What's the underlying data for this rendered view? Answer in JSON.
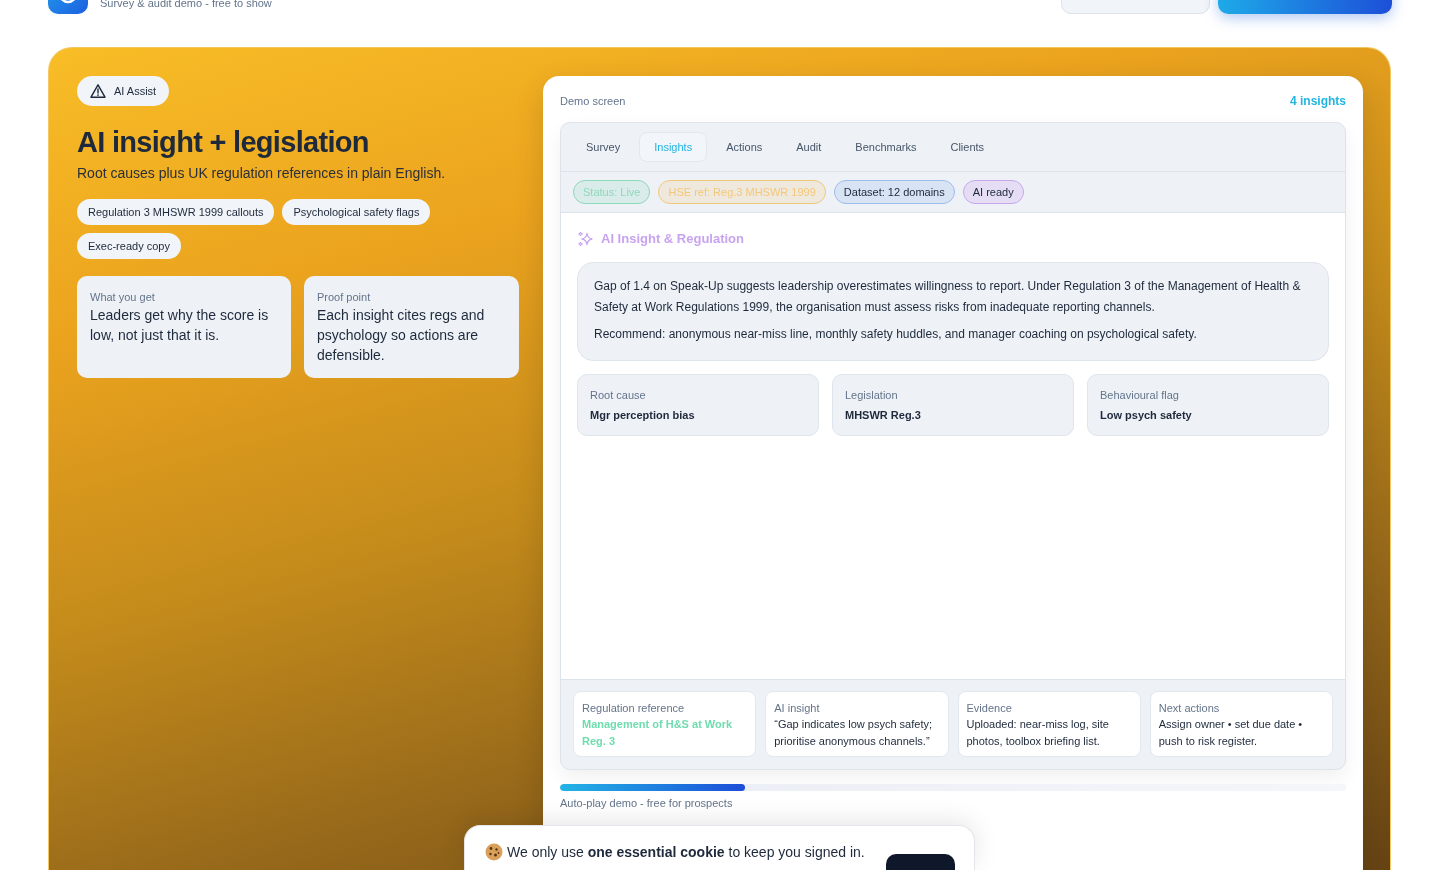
{
  "header": {
    "subtitle": "Survey & audit demo - free to show",
    "buttons": [
      {
        "kind": "outline"
      },
      {
        "kind": "primary"
      }
    ]
  },
  "hero": {
    "badge": "AI Assist",
    "title": "AI insight + legislation",
    "subtitle": "Root causes plus UK regulation references in plain English.",
    "tags": [
      "Regulation 3 MHSWR 1999 callouts",
      "Psychological safety flags",
      "Exec-ready copy"
    ],
    "cards": [
      {
        "label": "What you get",
        "text": "Leaders get why the score is low, not just that it is."
      },
      {
        "label": "Proof point",
        "text": "Each insight cites regs and psychology so actions are defensible."
      }
    ]
  },
  "demo": {
    "label": "Demo screen",
    "count": "4 insights",
    "tabs": [
      {
        "label": "Survey",
        "selected": false
      },
      {
        "label": "Insights",
        "selected": true
      },
      {
        "label": "Actions",
        "selected": false
      },
      {
        "label": "Audit",
        "selected": false
      },
      {
        "label": "Benchmarks",
        "selected": false
      },
      {
        "label": "Clients",
        "selected": false
      }
    ],
    "chips": [
      {
        "label": "Status: Live",
        "color": "#8ed8b8",
        "dimmed": true
      },
      {
        "label": "HSE ref: Reg.3 MHSWR 1999",
        "color": "#f3c77a",
        "dimmed": true
      },
      {
        "label": "Dataset: 12 domains",
        "color": "#9dbdec",
        "dimmed": false
      },
      {
        "label": "AI ready",
        "color": "#c9a6ee",
        "dimmed": false
      }
    ],
    "section_title": "AI Insight & Regulation",
    "insight": [
      "Gap of 1.4 on Speak-Up suggests leadership overestimates willingness to report. Under Regulation 3 of the Management of Health & Safety at Work Regulations 1999, the organisation must assess risks from inadequate reporting channels.",
      "Recommend: anonymous near-miss line, monthly safety huddles, and manager coaching on psychological safety."
    ],
    "facts": [
      {
        "label": "Root cause",
        "value": "Mgr perception bias"
      },
      {
        "label": "Legislation",
        "value": "MHSWR Reg.3"
      },
      {
        "label": "Behavioural flag",
        "value": "Low psych safety"
      }
    ],
    "details": [
      {
        "label": "Regulation reference",
        "text": "Management of H&S at Work Reg. 3",
        "highlighted": true
      },
      {
        "label": "AI insight",
        "text": "“Gap indicates low psych safety; prioritise anonymous channels.”",
        "highlighted": false
      },
      {
        "label": "Evidence",
        "text": "Uploaded: near-miss log, site photos, toolbox briefing list.",
        "highlighted": false
      },
      {
        "label": "Next actions",
        "text": "Assign owner • set due date • push to risk register.",
        "highlighted": false
      }
    ],
    "progress": {
      "level": 0.235
    },
    "caption": "Auto-play demo - free for prospects"
  },
  "cookie_banner": {
    "message": "We only use **one essential cookie** to keep you signed in.",
    "button": {
      "kind": "dark"
    }
  }
}
